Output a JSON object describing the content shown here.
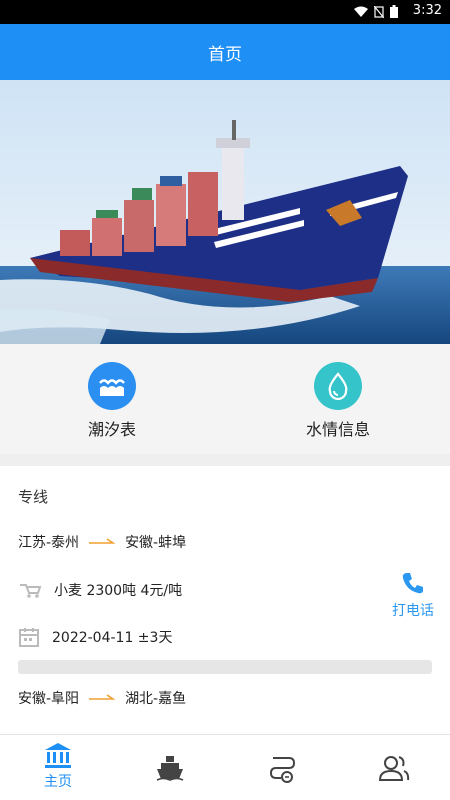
{
  "status_bar": {
    "time": "3:32"
  },
  "header": {
    "title": "首页"
  },
  "quick_links": [
    {
      "label": "潮汐表",
      "icon": "waves-icon",
      "color": "#2a8ff0"
    },
    {
      "label": "水情信息",
      "icon": "water-drop-icon",
      "color": "#35c4c9"
    }
  ],
  "routes": {
    "section_title": "专线",
    "items": [
      {
        "from": "江苏-泰州",
        "to": "安徽-蚌埠",
        "cargo": "小麦 2300吨 4元/吨",
        "date": "2022-04-11 ±3天"
      },
      {
        "from": "安徽-阜阳",
        "to": "湖北-嘉鱼"
      }
    ],
    "call_label": "打电话"
  },
  "tabbar": {
    "items": [
      {
        "label": "主页",
        "icon": "bank-icon"
      },
      {
        "icon": "ship-icon"
      },
      {
        "icon": "route-icon"
      },
      {
        "icon": "users-icon"
      }
    ],
    "active_color": "#1e8ff5"
  },
  "accent_orange": "#f0a030"
}
